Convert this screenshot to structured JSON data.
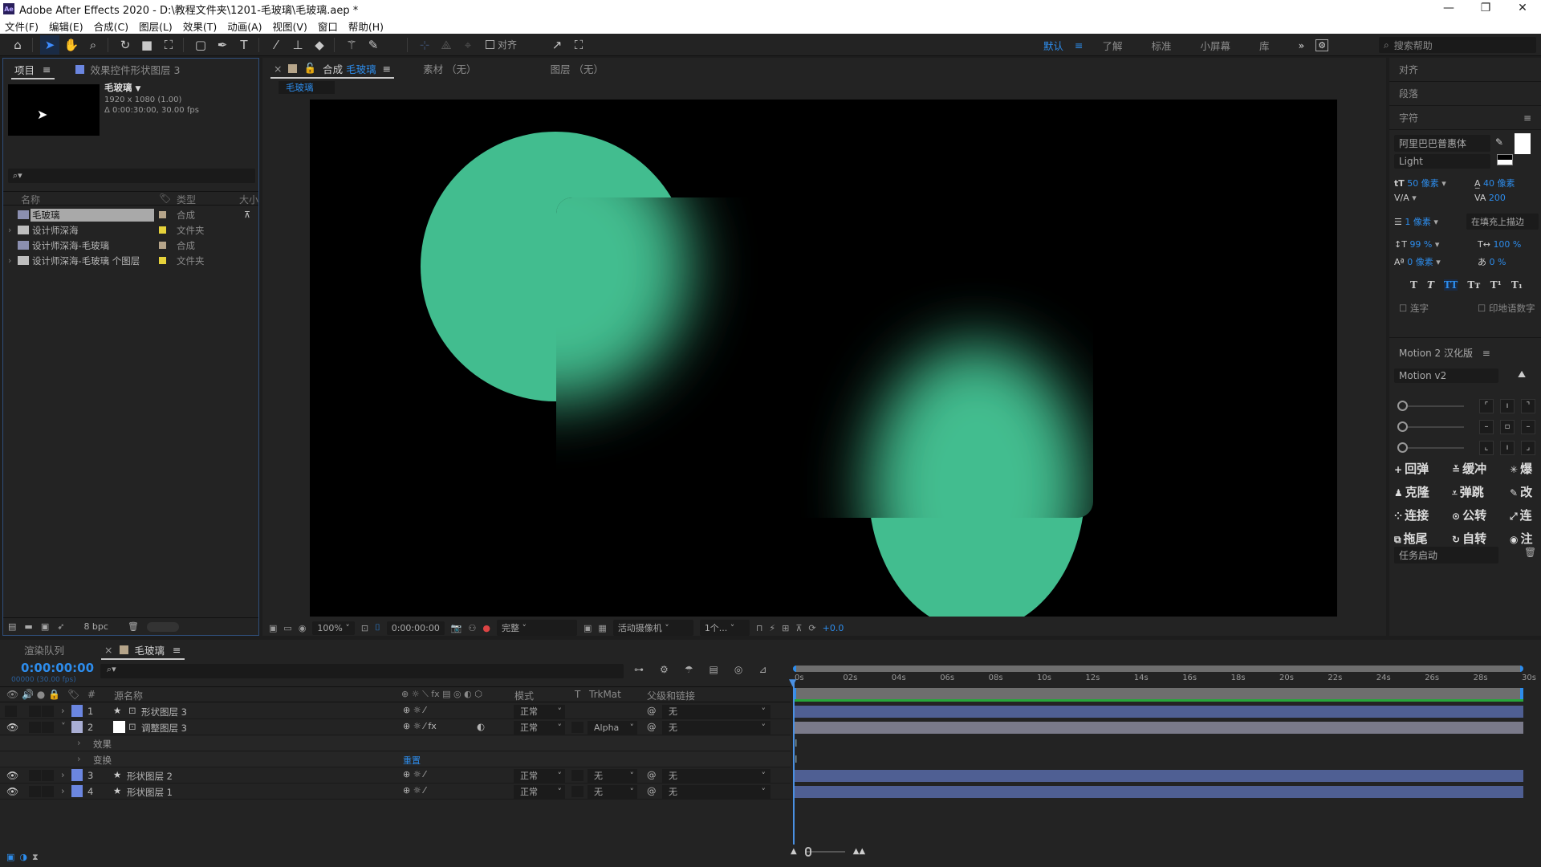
{
  "window": {
    "app_icon": "Ae",
    "title": "Adobe After Effects 2020 - D:\\教程文件夹\\1201-毛玻璃\\毛玻璃.aep *",
    "controls": [
      "—",
      "❐",
      "✕"
    ]
  },
  "menu": [
    "文件(F)",
    "编辑(E)",
    "合成(C)",
    "图层(L)",
    "效果(T)",
    "动画(A)",
    "视图(V)",
    "窗口",
    "帮助(H)"
  ],
  "toolbar": {
    "tools": [
      "home",
      "selection",
      "hand",
      "zoom",
      "rotate",
      "camera",
      "pan-behind",
      "rectangle",
      "pen",
      "type",
      "brush",
      "clone-stamp",
      "eraser",
      "roto-brush",
      "puppet-pin"
    ],
    "align_label": "对齐",
    "workspaces": {
      "current": "默认",
      "items": [
        "了解",
        "标准",
        "小屏幕",
        "库"
      ],
      "more": "»"
    },
    "search_placeholder": "搜索帮助"
  },
  "project": {
    "tab_label": "项目",
    "effects_tab": "效果控件形状图层 3",
    "selected": {
      "name": "毛玻璃",
      "dims": "1920 x 1080 (1.00)",
      "duration": "Δ 0:00:30:00, 30.00 fps"
    },
    "columns": {
      "name": "名称",
      "type": "类型",
      "size": "大小"
    },
    "items": [
      {
        "name": "毛玻璃",
        "type": "合成",
        "kind": "comp",
        "label": "#b6a58a",
        "selected": true
      },
      {
        "name": "设计师深海",
        "type": "文件夹",
        "kind": "folder",
        "label": "#e6d23a"
      },
      {
        "name": "设计师深海-毛玻璃",
        "type": "合成",
        "kind": "comp",
        "label": "#b6a58a"
      },
      {
        "name": "设计师深海-毛玻璃 个图层",
        "type": "文件夹",
        "kind": "folder",
        "label": "#e6d23a"
      }
    ],
    "bpc": "8 bpc"
  },
  "composition": {
    "tabs": [
      {
        "label_prefix": "合成",
        "label": "毛玻璃",
        "active": true
      },
      {
        "label": "素材 （无）"
      },
      {
        "label": "图层 （无）"
      }
    ],
    "breadcrumb": "毛玻璃",
    "viewer_bar": {
      "zoom": "100%",
      "timecode": "0:00:00:00",
      "resolution": "完整",
      "camera": "活动摄像机",
      "views": "1个...",
      "exposure": "+0.0"
    },
    "accent_color": "#42bd8f"
  },
  "right_panel": {
    "align": "对齐",
    "paragraph": "段落",
    "character": {
      "title": "字符",
      "font": "阿里巴巴普惠体",
      "style": "Light",
      "size": "50 像素",
      "leading": "40 像素",
      "kerning": "",
      "tracking": "200",
      "stroke": "1 像素",
      "stroke_mode": "在填充上描边",
      "vscale": "99 %",
      "hscale": "100 %",
      "baseline": "0 像素",
      "tsume": "0 %",
      "styles": [
        "T",
        "T",
        "TT",
        "Tт",
        "T¹",
        "T₁"
      ],
      "ligatures": "连字",
      "hindi": "印地语数字"
    },
    "motion": {
      "title": "Motion 2 汉化版",
      "version": "Motion v2",
      "buttons": [
        {
          "icon": "plus",
          "label": "回弹"
        },
        {
          "icon": "buffer",
          "label": "缓冲"
        },
        {
          "icon": "burst",
          "label": "爆"
        },
        {
          "icon": "clone",
          "label": "克隆"
        },
        {
          "icon": "bounce",
          "label": "弹跳"
        },
        {
          "icon": "pencil",
          "label": "改"
        },
        {
          "icon": "connect",
          "label": "连接"
        },
        {
          "icon": "orbit",
          "label": "公转"
        },
        {
          "icon": "link",
          "label": "连"
        },
        {
          "icon": "trail",
          "label": "拖尾"
        },
        {
          "icon": "spin",
          "label": "自转"
        },
        {
          "icon": "eye",
          "label": "注"
        }
      ],
      "task": "任务启动"
    }
  },
  "timeline": {
    "render_queue": "渲染队列",
    "comp_tab": "毛玻璃",
    "timecode": "0:00:00:00",
    "frame_info": "00000 (30.00 fps)",
    "columns": {
      "source": "源名称",
      "mode": "模式",
      "t": "T",
      "trkmat": "TrkMat",
      "parent": "父级和链接"
    },
    "layers": [
      {
        "num": "1",
        "name": "形状图层 3",
        "mode": "正常",
        "trkmat": "",
        "parent": "无",
        "color": "#6b86e0",
        "visible": false,
        "expanded": false,
        "type": "shape"
      },
      {
        "num": "2",
        "name": "调整图层 3",
        "mode": "正常",
        "trkmat": "Alpha",
        "parent": "无",
        "color": "#a9aed4",
        "visible": true,
        "expanded": true,
        "type": "adjust"
      },
      {
        "num": "3",
        "name": "形状图层 2",
        "mode": "正常",
        "trkmat": "无",
        "parent": "无",
        "color": "#6b86e0",
        "visible": true,
        "expanded": false,
        "type": "shape"
      },
      {
        "num": "4",
        "name": "形状图层 1",
        "mode": "正常",
        "trkmat": "无",
        "parent": "无",
        "color": "#6b86e0",
        "visible": true,
        "expanded": false,
        "type": "shape"
      }
    ],
    "sub_props": [
      "效果",
      "变换"
    ],
    "reset": "重置",
    "ruler": [
      "0s",
      "02s",
      "04s",
      "06s",
      "08s",
      "10s",
      "12s",
      "14s",
      "16s",
      "18s",
      "20s",
      "22s",
      "24s",
      "26s",
      "28s",
      "30s"
    ]
  }
}
